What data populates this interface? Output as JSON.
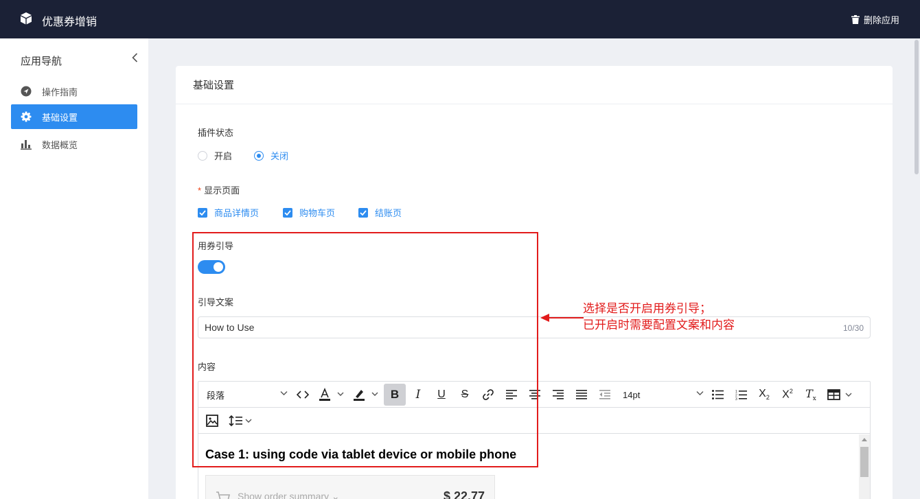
{
  "app": {
    "title": "优惠券增销",
    "delete_label": "删除应用"
  },
  "sidebar": {
    "title": "应用导航",
    "items": [
      {
        "label": "操作指南",
        "icon": "compass-icon",
        "active": false
      },
      {
        "label": "基础设置",
        "icon": "gear-icon",
        "active": true
      },
      {
        "label": "数据概览",
        "icon": "bar-chart-icon",
        "active": false
      }
    ]
  },
  "card": {
    "title": "基础设置"
  },
  "form": {
    "plugin_status": {
      "label": "插件状态",
      "options": [
        "开启",
        "关闭"
      ],
      "selected": "关闭"
    },
    "display_pages": {
      "label": "显示页面",
      "required": true,
      "options": [
        "商品详情页",
        "购物车页",
        "结账页"
      ],
      "checked": [
        "商品详情页",
        "购物车页",
        "结账页"
      ]
    },
    "coupon_guide": {
      "label": "用券引导",
      "enabled": true
    },
    "guide_text": {
      "label": "引导文案",
      "value": "How to Use",
      "count": "10/30"
    },
    "content": {
      "label": "内容",
      "toolbar": {
        "block_format": "段落",
        "font_size": "14pt"
      },
      "heading": "Case 1: using code via tablet device or mobile phone",
      "summary_text": "Show order summary ⌄",
      "summary_price": "$ 22.77"
    }
  },
  "annotation": {
    "line1": "选择是否开启用券引导；",
    "line2": "已开启时需要配置文案和内容",
    "color": "#e21b1b"
  },
  "colors": {
    "primary": "#2d8cf0",
    "topbar": "#1b2136",
    "annotation": "#e21b1b"
  }
}
